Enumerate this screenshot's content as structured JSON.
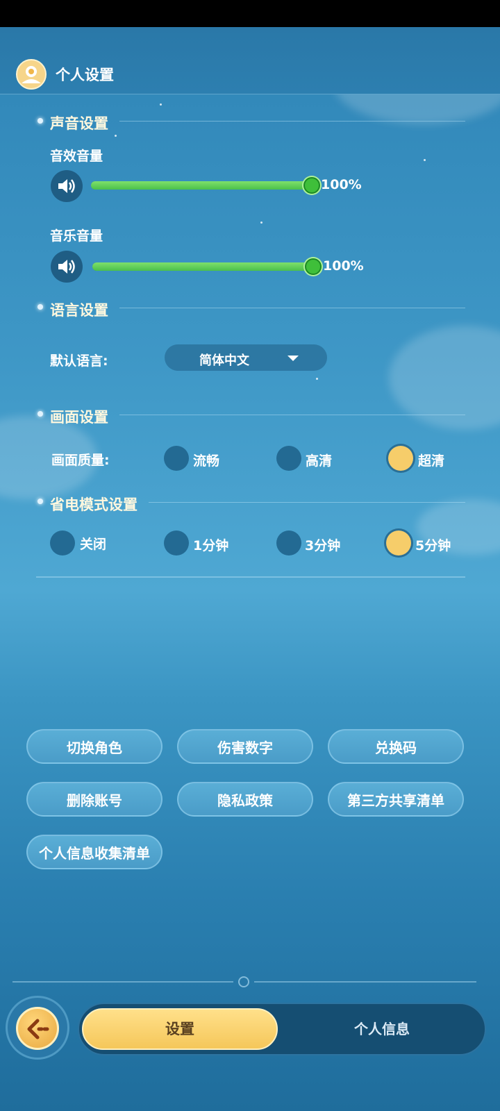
{
  "header": {
    "title": "个人设置",
    "icon": "profile-emblem-icon"
  },
  "sound": {
    "title": "声音设置",
    "sfx": {
      "label": "音效音量",
      "value": "100%",
      "level": 1.0
    },
    "music": {
      "label": "音乐音量",
      "value": "100%",
      "level": 1.0
    }
  },
  "language": {
    "title": "语言设置",
    "label": "默认语言:",
    "selected": "简体中文"
  },
  "graphics": {
    "title": "画面设置",
    "label": "画面质量:",
    "options": [
      "流畅",
      "高清",
      "超清"
    ],
    "selected": "超清"
  },
  "power": {
    "title": "省电模式设置",
    "options": [
      "关闭",
      "1分钟",
      "3分钟",
      "5分钟"
    ],
    "selected": "5分钟"
  },
  "actions": {
    "switch_role": "切换角色",
    "damage_numbers": "伤害数字",
    "redeem_code": "兑换码",
    "delete_account": "删除账号",
    "privacy_policy": "隐私政策",
    "third_party_list": "第三方共享清单",
    "personal_info_list": "个人信息收集清单"
  },
  "tabs": {
    "settings": "设置",
    "profile": "个人信息",
    "active": "设置"
  },
  "colors": {
    "accent_gold": "#f5c75a",
    "slider_green": "#4cc04b",
    "panel_blue": "#2f85b7"
  }
}
